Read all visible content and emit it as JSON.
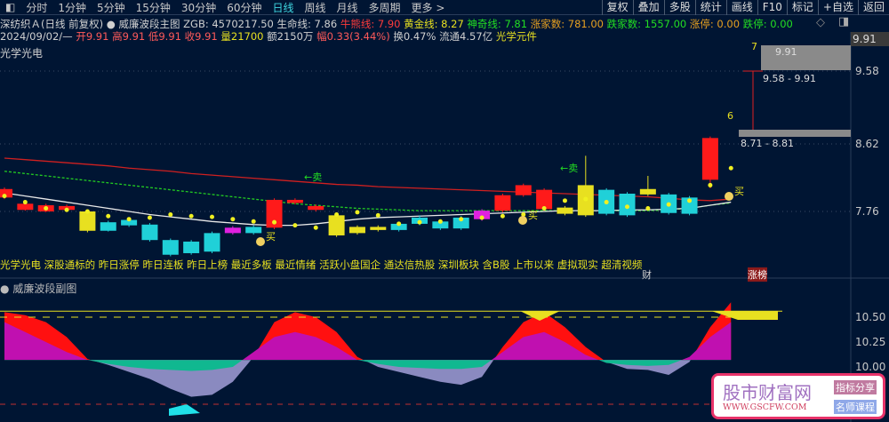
{
  "toolbar": {
    "periods": [
      "分时",
      "1分钟",
      "5分钟",
      "15分钟",
      "30分钟",
      "60分钟",
      "日线",
      "周线",
      "月线",
      "多周期",
      "更多 >"
    ],
    "active": "日线",
    "right_buttons": [
      "复权",
      "叠加",
      "多股",
      "统计",
      "画线",
      "F10",
      "标记",
      "+自选",
      "返回"
    ]
  },
  "header": {
    "stock": "深纺织Ａ(日线 前复权)",
    "indicator": "威廉波段主图",
    "zgb": "ZGB: 4570217.50",
    "smx": "生命线: 7.86",
    "nxx": "牛熊线: 7.90",
    "hjx": "黄金线: 8.27",
    "sqx": "神奇线: 7.81",
    "zjs": "涨家数: 781.00",
    "djs": "跌家数: 1557.00",
    "zt": "涨停: 0.00",
    "dt": "跌停: 0.00"
  },
  "quote": {
    "date": "2024/09/02/—",
    "open": "开9.91",
    "high": "高9.91",
    "low": "低9.91",
    "close": "收9.91",
    "vol": "量21700",
    "amt": "额2150万",
    "chg": "幅0.33(3.44%)",
    "turn": "换0.47%",
    "float": "流通4.57亿",
    "sector": "光学元件"
  },
  "sector_label": "光学光电",
  "tags": "光学光电 深股通标的 昨日涨停 昨日连板 昨日上榜 最近多板 最近情绪 活跃小盘国企 通达信热股 深圳板块 含B股 上市以来 虚拟现实 超清视频",
  "markers": {
    "cai": "财",
    "zhangbang": "涨榜",
    "sell": "←卖",
    "buy": "买"
  },
  "zones": {
    "z1": "9.58 - 9.91",
    "z2": "8.71 - 8.81",
    "z_top": "9.91",
    "count6": "6",
    "count7": "7"
  },
  "main_axis": {
    "labels": [
      "9.91",
      "9.58",
      "8.62",
      "7.76"
    ],
    "current": "9.91"
  },
  "sub": {
    "title": "威廉波段副图",
    "labels": [
      "10.50",
      "10.25",
      "10.00"
    ]
  },
  "watermark": {
    "name": "股市财富网",
    "url": "WWW.GSCFW.COM",
    "tag1": "指标分享",
    "tag2": "名师课程"
  },
  "colors": {
    "up": "#ff1a1a",
    "down": "#20d0d8",
    "yellow": "#e8e020",
    "magenta": "#e020e0",
    "bg": "#001533"
  },
  "chart_data": {
    "type": "candlestick",
    "price_range": [
      7.2,
      10.0
    ],
    "candles": [
      [
        7.94,
        8.05,
        8.07,
        7.92,
        "up"
      ],
      [
        7.78,
        7.86,
        7.88,
        7.77,
        "up"
      ],
      [
        7.76,
        7.84,
        7.86,
        7.75,
        "up"
      ],
      [
        7.78,
        7.83,
        7.85,
        7.77,
        "up"
      ],
      [
        7.76,
        7.51,
        7.78,
        7.49,
        "yellow"
      ],
      [
        7.62,
        7.51,
        7.64,
        7.5,
        "down"
      ],
      [
        7.65,
        7.58,
        7.68,
        7.56,
        "down"
      ],
      [
        7.59,
        7.39,
        7.61,
        7.37,
        "down"
      ],
      [
        7.39,
        7.2,
        7.41,
        7.18,
        "down"
      ],
      [
        7.37,
        7.22,
        7.39,
        7.2,
        "down"
      ],
      [
        7.48,
        7.24,
        7.5,
        7.22,
        "down"
      ],
      [
        7.55,
        7.48,
        7.57,
        7.46,
        "magenta"
      ],
      [
        7.56,
        7.48,
        7.58,
        7.46,
        "down"
      ],
      [
        7.55,
        7.91,
        7.93,
        7.53,
        "up"
      ],
      [
        7.87,
        7.91,
        7.93,
        7.85,
        "up"
      ],
      [
        7.78,
        7.83,
        7.85,
        7.76,
        "up"
      ],
      [
        7.71,
        7.45,
        7.73,
        7.43,
        "yellow"
      ],
      [
        7.56,
        7.48,
        7.58,
        7.46,
        "yellow"
      ],
      [
        7.52,
        7.56,
        7.58,
        7.5,
        "yellow"
      ],
      [
        7.6,
        7.52,
        7.62,
        7.5,
        "down"
      ],
      [
        7.68,
        7.6,
        7.71,
        7.58,
        "down"
      ],
      [
        7.63,
        7.54,
        7.65,
        7.52,
        "down"
      ],
      [
        7.68,
        7.54,
        7.7,
        7.52,
        "down"
      ],
      [
        7.66,
        7.77,
        7.79,
        7.64,
        "magenta"
      ],
      [
        7.77,
        7.97,
        7.99,
        7.75,
        "up"
      ],
      [
        7.97,
        8.1,
        8.12,
        7.95,
        "up"
      ],
      [
        7.79,
        8.04,
        8.06,
        7.77,
        "up"
      ],
      [
        7.73,
        7.81,
        7.83,
        7.71,
        "yellow"
      ],
      [
        7.71,
        8.1,
        8.48,
        7.69,
        "yellow"
      ],
      [
        8.04,
        7.73,
        8.06,
        7.71,
        "down"
      ],
      [
        7.99,
        7.71,
        8.01,
        7.69,
        "down"
      ],
      [
        7.98,
        8.05,
        8.22,
        7.96,
        "yellow"
      ],
      [
        7.98,
        7.74,
        8.0,
        7.72,
        "down"
      ],
      [
        7.94,
        7.73,
        7.96,
        7.71,
        "down"
      ],
      [
        8.17,
        8.71,
        8.73,
        8.06,
        "up"
      ]
    ],
    "ma_red": [
      8.45,
      8.43,
      8.41,
      8.39,
      8.37,
      8.35,
      8.32,
      8.3,
      8.28,
      8.25,
      8.23,
      8.21,
      8.19,
      8.17,
      8.15,
      8.13,
      8.11,
      8.1,
      8.08,
      8.07,
      8.06,
      8.05,
      8.04,
      8.03,
      8.02,
      8.01,
      8.0,
      7.99,
      7.98,
      7.97,
      7.96,
      7.95,
      7.93,
      7.91,
      7.9,
      7.92
    ],
    "ma_white": [
      8.0,
      7.96,
      7.92,
      7.88,
      7.84,
      7.8,
      7.76,
      7.72,
      7.69,
      7.66,
      7.63,
      7.61,
      7.59,
      7.58,
      7.58,
      7.6,
      7.63,
      7.66,
      7.68,
      7.69,
      7.7,
      7.71,
      7.72,
      7.73,
      7.74,
      7.75,
      7.76,
      7.77,
      7.77,
      7.77,
      7.78,
      7.78,
      7.79,
      7.8,
      7.84,
      7.88
    ],
    "ma_green": [
      8.28,
      8.25,
      8.22,
      8.19,
      8.16,
      8.13,
      8.1,
      8.07,
      8.04,
      8.01,
      7.98,
      7.95,
      7.92,
      7.89,
      7.86,
      7.84,
      7.82,
      7.8,
      7.79,
      7.78,
      7.77,
      7.77,
      7.77,
      7.77,
      7.77,
      7.77,
      7.77,
      7.77,
      7.77,
      7.77,
      7.77,
      7.77,
      7.78,
      7.8,
      7.84,
      7.87
    ],
    "dots": [
      7.96,
      7.88,
      7.8,
      7.78,
      7.76,
      7.7,
      7.66,
      7.68,
      7.72,
      7.7,
      7.69,
      7.66,
      7.63,
      7.62,
      7.58,
      7.55,
      7.72,
      7.75,
      7.71,
      7.6,
      7.62,
      7.63,
      7.66,
      7.68,
      7.7,
      7.72,
      7.8,
      7.9,
      7.92,
      7.88,
      7.82,
      7.8,
      7.85,
      7.9,
      8.1,
      8.32
    ],
    "sub_range": [
      9.55,
      10.7
    ],
    "sub_base": 10.07,
    "sub_outer": [
      10.55,
      10.52,
      10.45,
      10.3,
      10.08,
      10.02,
      9.95,
      9.88,
      9.78,
      9.7,
      9.72,
      9.85,
      10.1,
      10.45,
      10.55,
      10.5,
      10.35,
      10.1,
      10.0,
      9.95,
      9.9,
      9.85,
      9.82,
      9.9,
      10.2,
      10.45,
      10.55,
      10.4,
      10.2,
      10.05,
      9.98,
      9.97,
      9.92,
      10.05,
      10.4,
      10.65
    ],
    "sub_inner": [
      10.45,
      10.35,
      10.25,
      10.15,
      10.07,
      10.03,
      10.0,
      9.98,
      9.97,
      9.96,
      9.97,
      10.0,
      10.15,
      10.3,
      10.35,
      10.3,
      10.2,
      10.07,
      10.03,
      10.0,
      9.99,
      9.98,
      9.98,
      10.0,
      10.15,
      10.3,
      10.35,
      10.25,
      10.12,
      10.04,
      10.02,
      10.01,
      10.02,
      10.1,
      10.3,
      10.45
    ],
    "sub_level": 10.56
  }
}
